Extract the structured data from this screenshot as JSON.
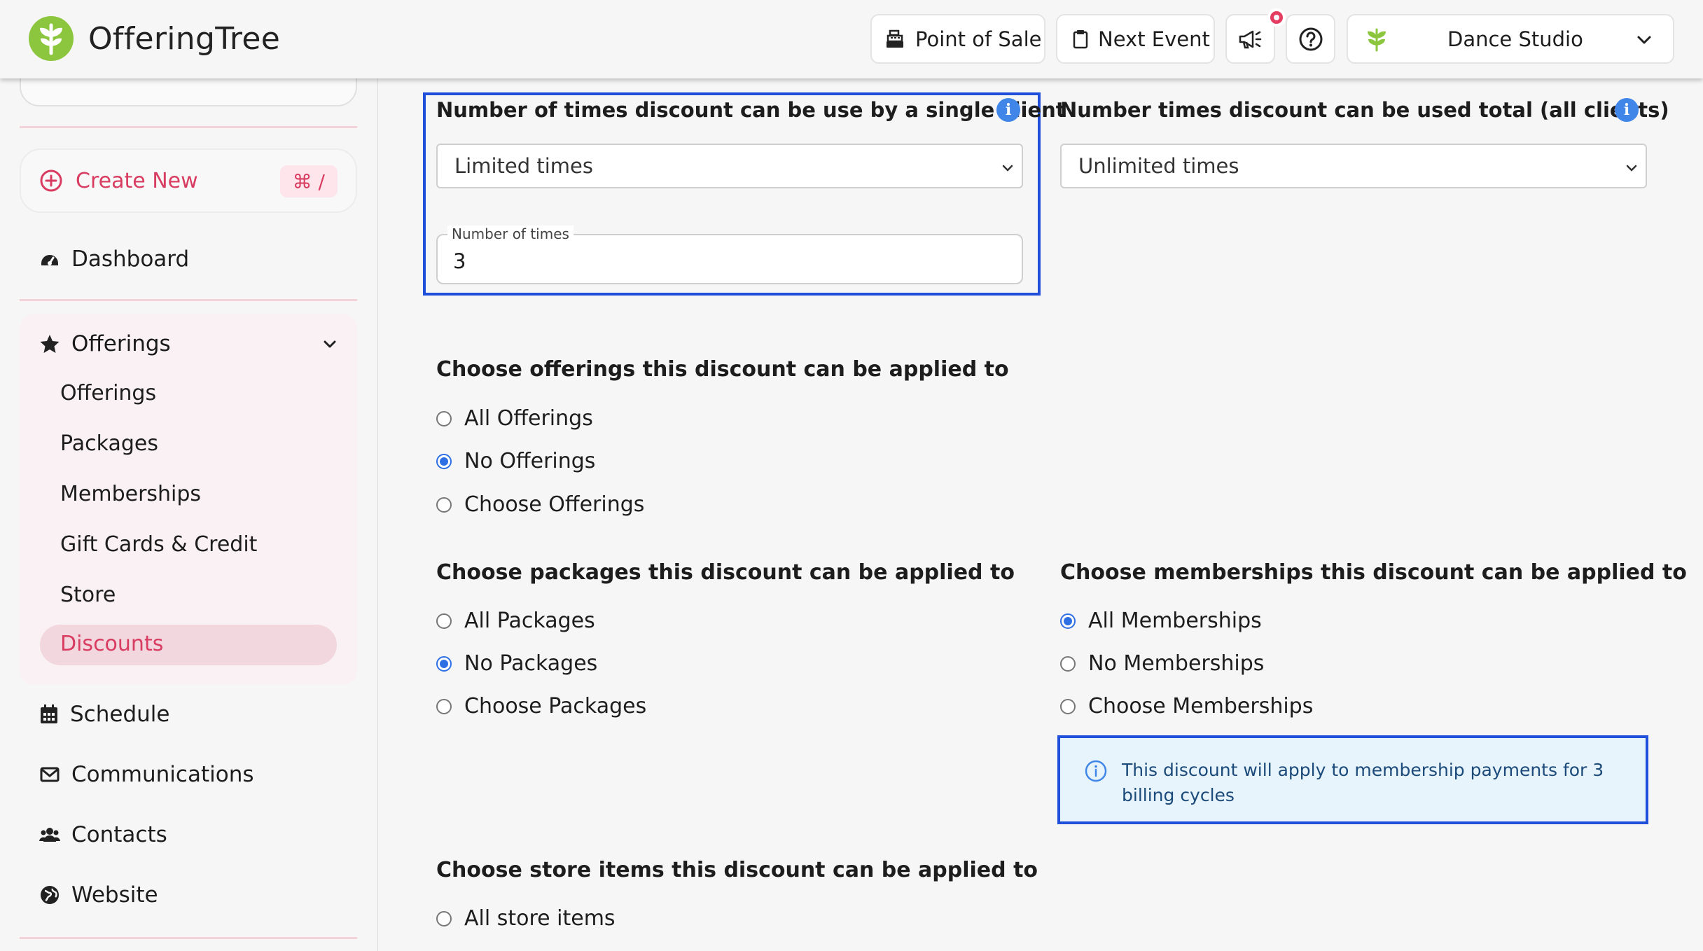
{
  "app": {
    "name": "OfferingTree"
  },
  "header": {
    "point_of_sale": "Point of Sale",
    "next_event": "Next Event",
    "studio": "Dance Studio"
  },
  "sidebar": {
    "create_new": "Create New",
    "create_new_shortcut": "⌘ /",
    "dashboard": "Dashboard",
    "offerings_group": "Offerings",
    "sub_items": [
      "Offerings",
      "Packages",
      "Memberships",
      "Gift Cards & Credit",
      "Store"
    ],
    "active_item": "Discounts",
    "schedule": "Schedule",
    "communications": "Communications",
    "contacts": "Contacts",
    "website": "Website"
  },
  "form": {
    "single_client": {
      "title": "Number of times discount can be use by a single client",
      "value": "Limited times",
      "times_label": "Number of times",
      "times_value": "3"
    },
    "total": {
      "title": "Number times discount can be used total (all clients)",
      "value": "Unlimited times"
    },
    "offerings": {
      "title": "Choose offerings this discount can be applied to",
      "options": [
        "All Offerings",
        "No Offerings",
        "Choose Offerings"
      ],
      "selected": "No Offerings"
    },
    "packages": {
      "title": "Choose packages this discount can be applied to",
      "options": [
        "All Packages",
        "No Packages",
        "Choose Packages"
      ],
      "selected": "No Packages"
    },
    "memberships": {
      "title": "Choose memberships this discount can be applied to",
      "options": [
        "All Memberships",
        "No Memberships",
        "Choose Memberships"
      ],
      "selected": "All Memberships",
      "notice": "This discount will apply to membership payments for 3 billing cycles"
    },
    "store": {
      "title": "Choose store items this discount can be applied to",
      "options": [
        "All store items"
      ]
    }
  },
  "colors": {
    "brand_green": "#8cc63f",
    "accent_pink": "#d93c61",
    "radio_blue": "#2f6fe4",
    "highlight_border": "#1f4fdb"
  }
}
